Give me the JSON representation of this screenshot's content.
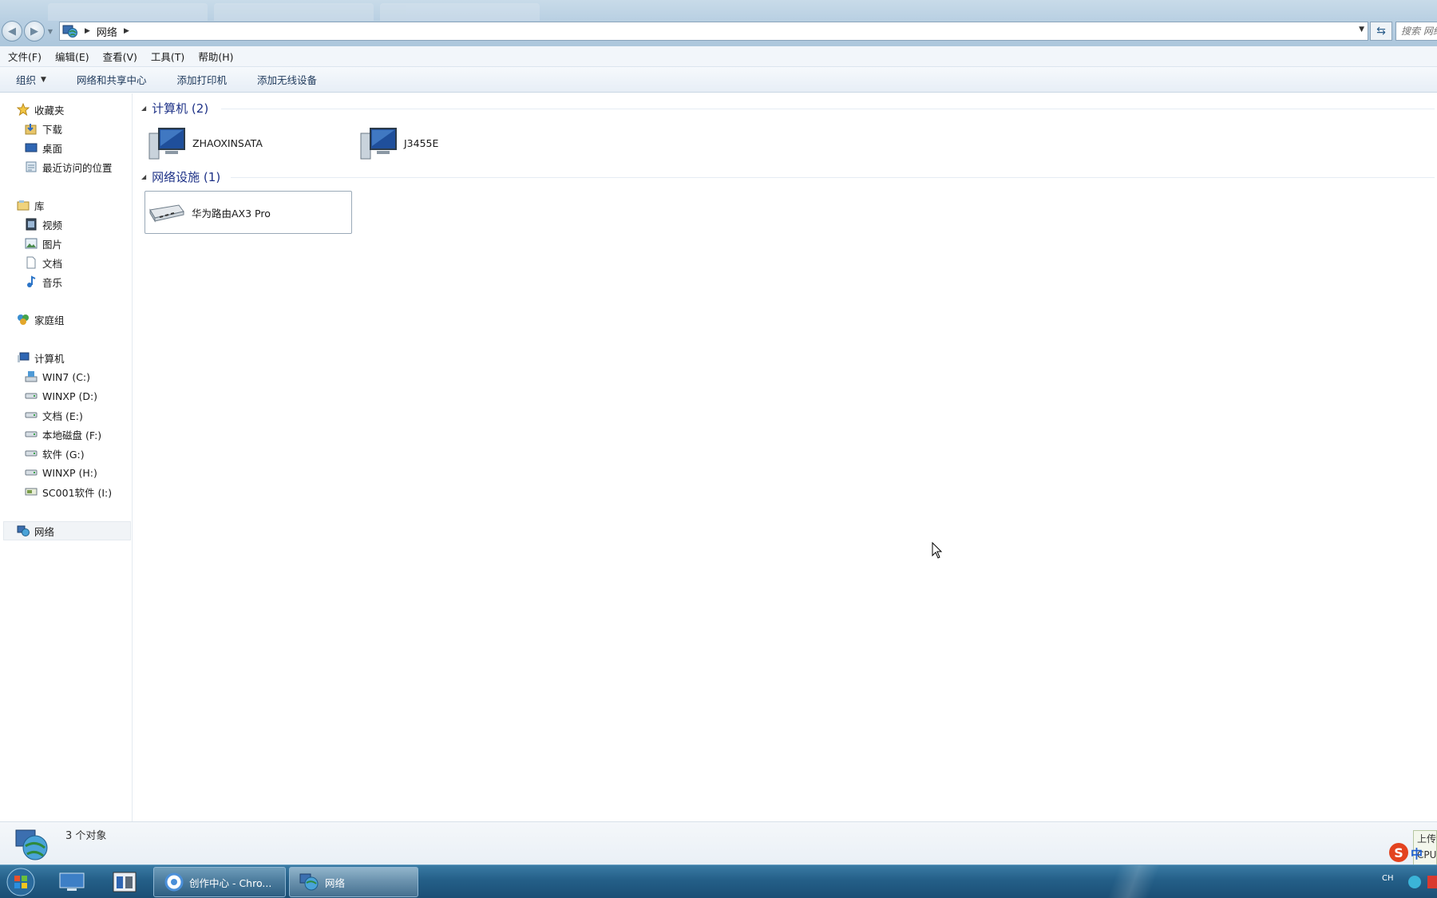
{
  "window": {
    "breadcrumb": "网络",
    "search_placeholder": "搜索 网络"
  },
  "menu": [
    "文件(F)",
    "编辑(E)",
    "查看(V)",
    "工具(T)",
    "帮助(H)"
  ],
  "commands": {
    "organize": "组织",
    "network_center": "网络和共享中心",
    "add_printer": "添加打印机",
    "add_wireless": "添加无线设备"
  },
  "sidebar": {
    "favorites": "收藏夹",
    "downloads": "下载",
    "desktop": "桌面",
    "recent": "最近访问的位置",
    "libraries": "库",
    "videos": "视频",
    "pictures": "图片",
    "documents": "文档",
    "music": "音乐",
    "homegroup": "家庭组",
    "computer": "计算机",
    "drives": [
      "WIN7 (C:)",
      "WINXP (D:)",
      "文档 (E:)",
      "本地磁盘 (F:)",
      "软件 (G:)",
      "WINXP (H:)",
      "SC001软件 (I:)"
    ],
    "network": "网络"
  },
  "main": {
    "computers_header": "计算机 (2)",
    "computers": [
      "ZHAOXINSATA",
      "J3455E"
    ],
    "devices_header": "网络设施 (1)",
    "devices": [
      "华为路由AX3 Pro"
    ]
  },
  "status": {
    "count": "3 个对象",
    "side_widget": "上传\nCPU"
  },
  "taskbar": {
    "chrome_task": "创作中心 - Chro...",
    "network_task": "网络",
    "lang": "CH",
    "ime_logo": "S",
    "ime_mode": "中"
  },
  "colors": {
    "group_header": "#1e3287",
    "taskbar": "#245f88",
    "chrome": "#b8cfe2"
  }
}
